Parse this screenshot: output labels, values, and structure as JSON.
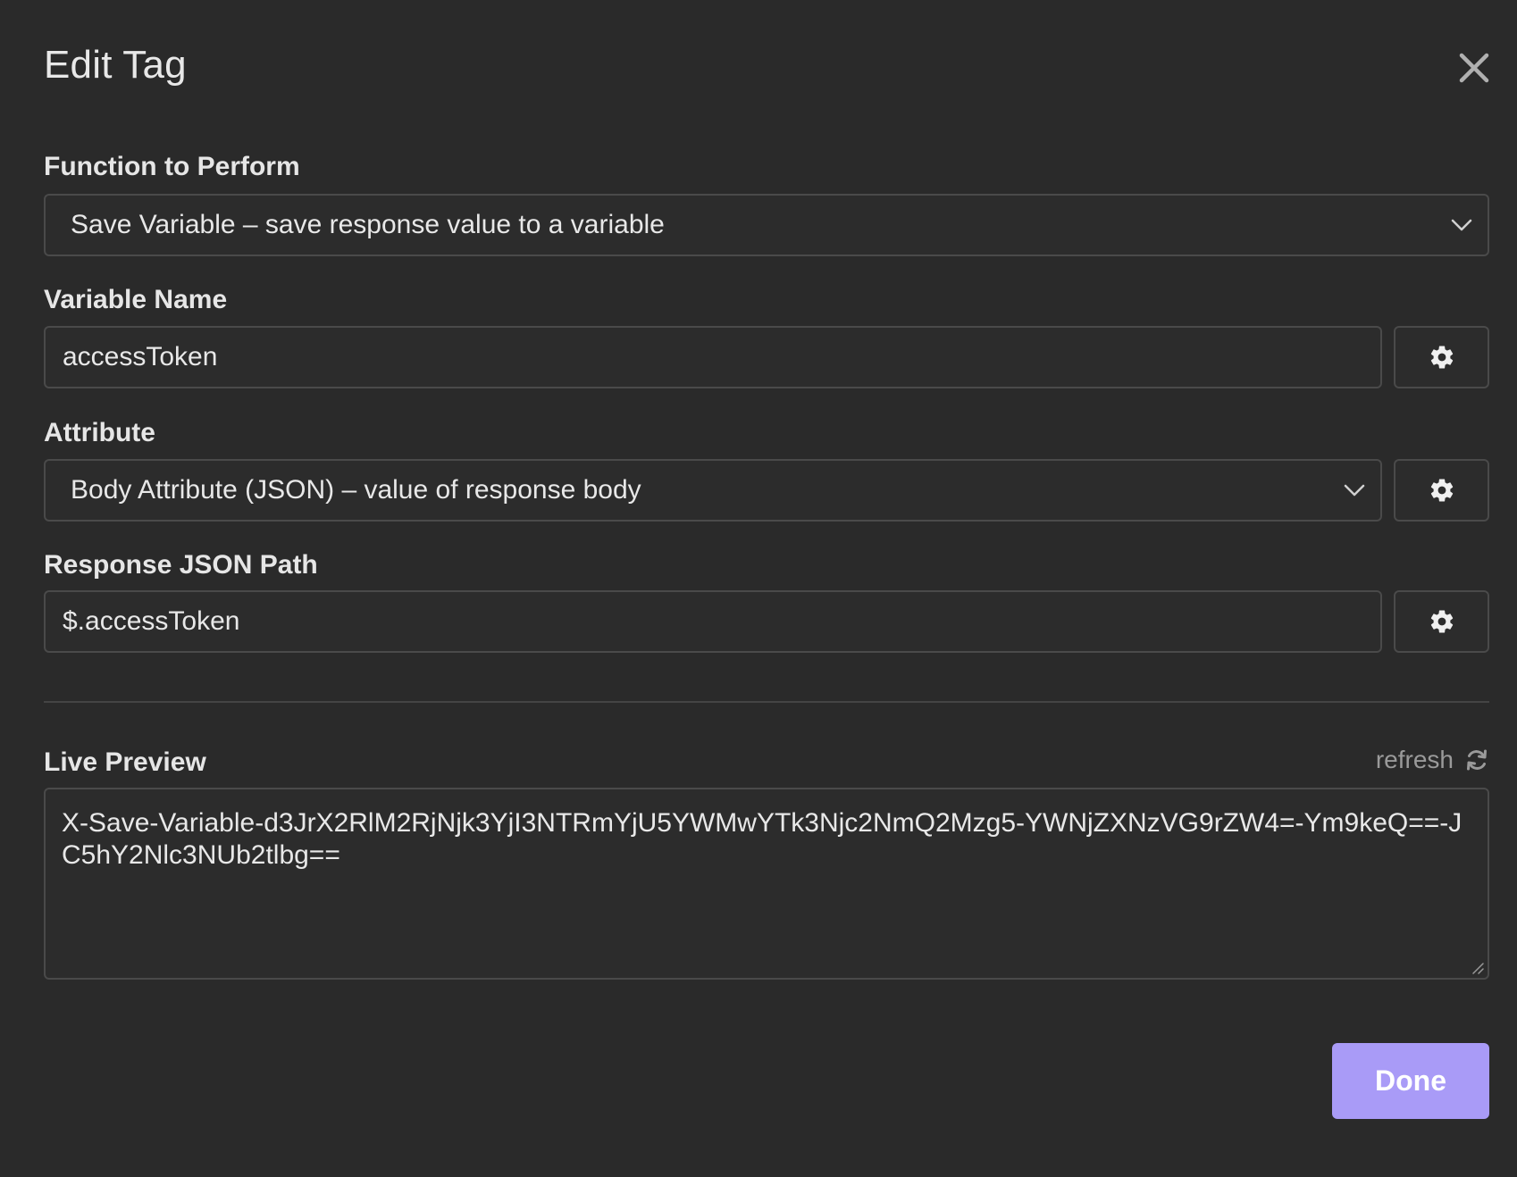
{
  "dialog": {
    "title": "Edit Tag",
    "close_icon": "close-icon"
  },
  "function_to_perform": {
    "label": "Function to Perform",
    "selected": "Save Variable – save response value to a variable"
  },
  "variable_name": {
    "label": "Variable Name",
    "value": "accessToken",
    "settings_icon": "gear-icon"
  },
  "attribute": {
    "label": "Attribute",
    "selected": "Body Attribute (JSON) – value of response body",
    "settings_icon": "gear-icon"
  },
  "response_json_path": {
    "label": "Response JSON Path",
    "value": "$.accessToken",
    "settings_icon": "gear-icon"
  },
  "live_preview": {
    "label": "Live Preview",
    "refresh_label": "refresh",
    "refresh_icon": "refresh-icon",
    "value": "X-Save-Variable-d3JrX2RlM2RjNjk3YjI3NTRmYjU5YWMwYTk3Njc2NmQ2Mzg5-YWNjZXNzVG9rZW4=-Ym9keQ==-JC5hY2Nlc3NUb2tlbg=="
  },
  "footer": {
    "done_label": "Done"
  },
  "colors": {
    "background": "#2a2a2a",
    "field_border": "#4a4a4a",
    "accent": "#a99bf7",
    "muted_text": "#9a9a9a"
  }
}
